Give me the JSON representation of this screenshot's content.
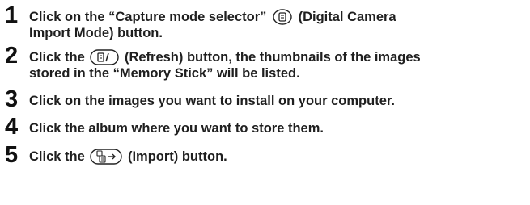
{
  "steps": [
    {
      "number": "1",
      "before_icon": "Click on the “Capture mode selector” ",
      "icon": "digital-camera-import-mode-icon",
      "after_icon": " (Digital Camera",
      "line2": "Import Mode) button."
    },
    {
      "number": "2",
      "before_icon": "Click the ",
      "icon": "refresh-icon",
      "after_icon": " (Refresh) button, the thumbnails of the images",
      "line2": "stored in the “Memory Stick” will be listed."
    },
    {
      "number": "3",
      "text": "Click on the images you want to install on your computer."
    },
    {
      "number": "4",
      "text": "Click the album where you want to store them."
    },
    {
      "number": "5",
      "before_icon": "Click the ",
      "icon": "import-icon",
      "after_icon": " (Import) button."
    }
  ]
}
